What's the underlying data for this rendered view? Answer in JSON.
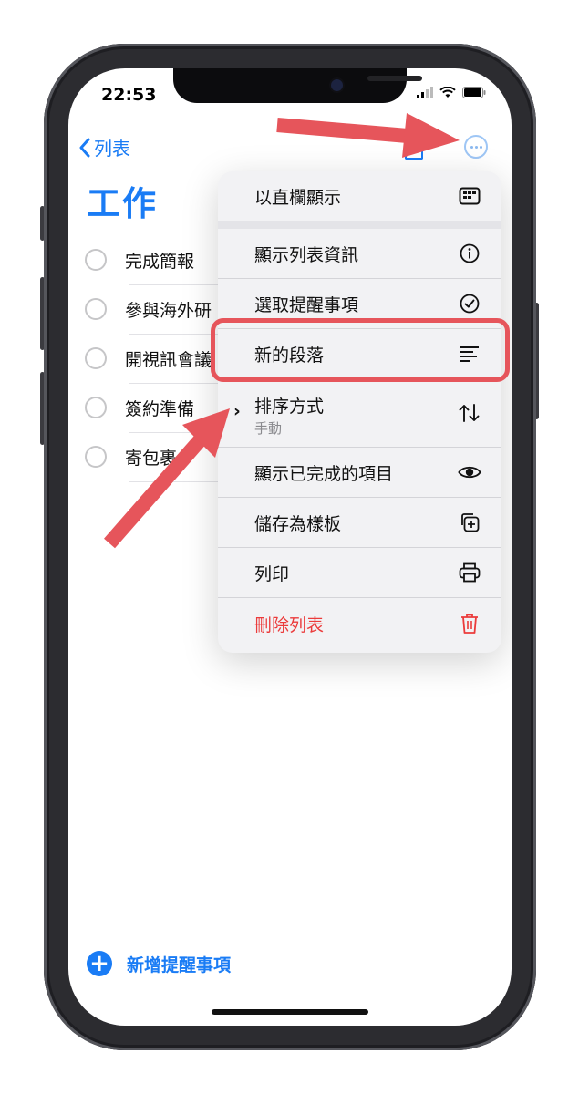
{
  "status": {
    "time": "22:53"
  },
  "nav": {
    "back_label": "列表"
  },
  "list": {
    "title": "工作"
  },
  "todos": [
    "完成簡報",
    "參與海外研",
    "開視訊會議",
    "簽約準備",
    "寄包裹"
  ],
  "add_label": "新增提醒事項",
  "menu": {
    "items": [
      {
        "label": "以直欄顯示",
        "icon": "column-view-icon"
      },
      {
        "label": "顯示列表資訊",
        "icon": "info-icon"
      },
      {
        "label": "選取提醒事項",
        "icon": "checkmark-circle-icon"
      },
      {
        "label": "新的段落",
        "icon": "text-align-left-icon"
      },
      {
        "label": "排序方式",
        "sub": "手動",
        "icon": "sort-arrows-icon"
      },
      {
        "label": "顯示已完成的項目",
        "icon": "eye-icon"
      },
      {
        "label": "儲存為樣板",
        "icon": "duplicate-icon"
      },
      {
        "label": "列印",
        "icon": "printer-icon"
      },
      {
        "label": "刪除列表",
        "icon": "trash-icon"
      }
    ]
  },
  "colors": {
    "accent": "#1a7cf5",
    "danger": "#eb3b3b",
    "annotation": "#e6555b"
  }
}
